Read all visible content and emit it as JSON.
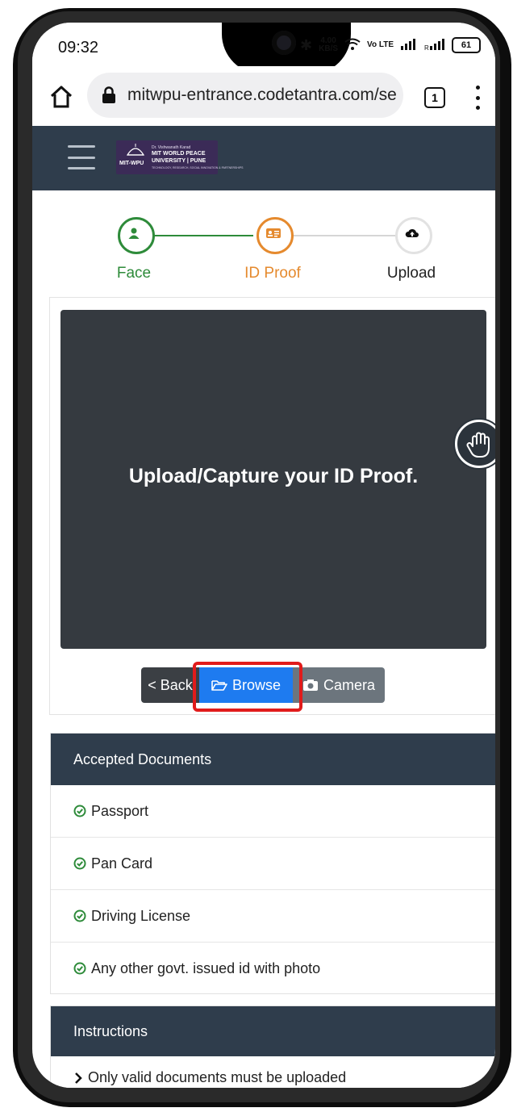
{
  "status_bar": {
    "time": "09:32",
    "network_speed": "4.00",
    "network_unit": "KB/S",
    "volte": "Vo LTE",
    "battery": "61"
  },
  "browser": {
    "url": "mitwpu-entrance.codetantra.com/se",
    "tab_count": "1"
  },
  "site_logo": {
    "short": "MIT-WPU",
    "line1": "Dr. Vishwanath Karad",
    "line2": "MIT WORLD PEACE",
    "line3": "UNIVERSITY | PUNE",
    "tagline": "TECHNOLOGY, RESEARCH, SOCIAL INNOVATION & PARTNERSHIPS"
  },
  "stepper": {
    "steps": [
      {
        "label": "Face",
        "state": "done",
        "icon": "user-icon",
        "color": "#2e8b3a"
      },
      {
        "label": "ID Proof",
        "state": "active",
        "icon": "id-card-icon",
        "color": "#e58a2e"
      },
      {
        "label": "Upload",
        "state": "pending",
        "icon": "cloud-upload-icon",
        "color": "#222222"
      }
    ]
  },
  "capture": {
    "prompt": "Upload/Capture your ID Proof.",
    "back_label": "< Back",
    "browse_label": "Browse",
    "camera_label": "Camera"
  },
  "accepted_documents": {
    "title": "Accepted Documents",
    "items": [
      "Passport",
      "Pan Card",
      "Driving License",
      "Any other govt. issued id with photo"
    ]
  },
  "instructions": {
    "title": "Instructions",
    "items": [
      "Only valid documents must be uploaded"
    ]
  },
  "colors": {
    "header_bg": "#2f3d4c",
    "primary": "#1e7bf0",
    "success": "#2e8b3a",
    "warning": "#e58a2e",
    "highlight": "#e11b1b"
  }
}
